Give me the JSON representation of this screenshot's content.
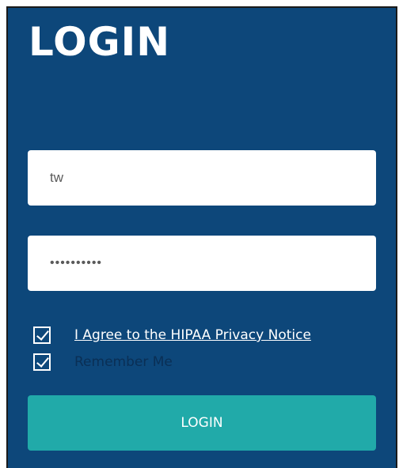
{
  "login": {
    "title": "LOGIN",
    "username": {
      "value": "tw"
    },
    "password": {
      "value": "••••••••••"
    },
    "agree_label": "I Agree to the HIPAA Privacy Notice",
    "agree_checked": true,
    "remember_label": "Remember Me",
    "remember_checked": true,
    "button_label": "LOGIN"
  },
  "colors": {
    "panel_background": "#0d477a",
    "button_background": "#21aaa9",
    "field_background": "#ffffff"
  }
}
